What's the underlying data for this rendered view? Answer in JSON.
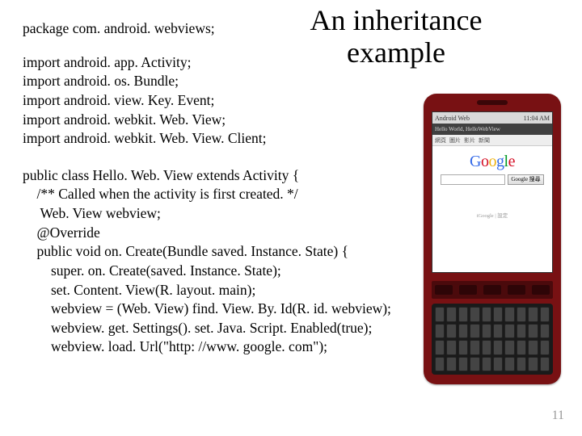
{
  "title_line1": "An inheritance",
  "title_line2": "example",
  "code": {
    "package": "package com. android. webviews;",
    "imports": [
      "import android. app. Activity;",
      "import android. os. Bundle;",
      "import android. view. Key. Event;",
      "import android. webkit. Web. View;",
      "import android. webkit. Web. View. Client;"
    ],
    "body": [
      "public class Hello. Web. View extends Activity {",
      "    /** Called when the activity is first created. */",
      "     Web. View webview;",
      "    @Override",
      "    public void on. Create(Bundle saved. Instance. State) {",
      "        super. on. Create(saved. Instance. State);",
      "        set. Content. View(R. layout. main);",
      "        webview = (Web. View) find. View. By. Id(R. id. webview);",
      "        webview. get. Settings(). set. Java. Script. Enabled(true);",
      "        webview. load. Url(\"http: //www. google. com\");"
    ]
  },
  "phone": {
    "status_left": "Android Web",
    "status_time": "11:04 AM",
    "addr": "Hello World, HelloWebView",
    "toolbar": [
      "網頁",
      "圖片",
      "影片",
      "新聞"
    ],
    "search_btn": "Google 搜尋",
    "footer": "iGoogle   |   設定"
  },
  "page_number": "11"
}
